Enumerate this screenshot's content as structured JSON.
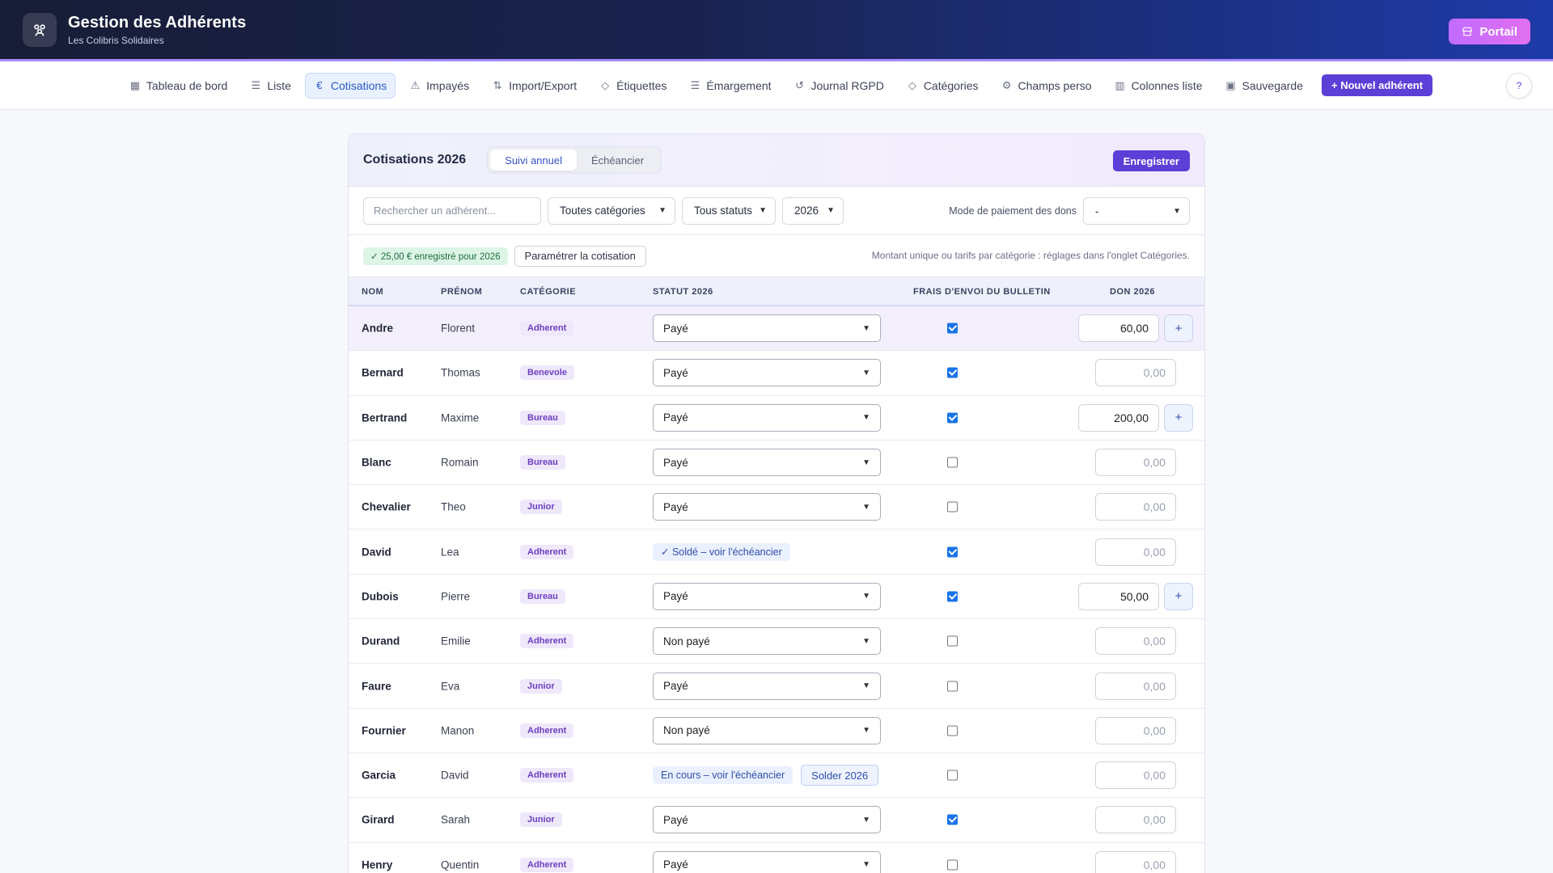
{
  "app": {
    "title": "Gestion des Adhérents",
    "subtitle": "Les Colibris Solidaires",
    "portal_label": "Portail"
  },
  "nav": {
    "items": [
      {
        "label": "Tableau de bord",
        "icon": "grid-icon"
      },
      {
        "label": "Liste",
        "icon": "list-icon"
      },
      {
        "label": "Cotisations",
        "icon": "euro-icon",
        "active": true
      },
      {
        "label": "Impayés",
        "icon": "warning-icon"
      },
      {
        "label": "Import/Export",
        "icon": "file-icon"
      },
      {
        "label": "Étiquettes",
        "icon": "tag-icon"
      },
      {
        "label": "Émargement",
        "icon": "list-icon"
      },
      {
        "label": "Journal RGPD",
        "icon": "history-icon"
      },
      {
        "label": "Catégories",
        "icon": "tag-icon"
      },
      {
        "label": "Champs perso",
        "icon": "gear-icon"
      },
      {
        "label": "Colonnes liste",
        "icon": "columns-icon"
      },
      {
        "label": "Sauvegarde",
        "icon": "save-icon"
      }
    ],
    "new_label": "+ Nouvel adhérent",
    "help_label": "?"
  },
  "card": {
    "title": "Cotisations 2026",
    "tabs": [
      "Suivi annuel",
      "Échéancier"
    ],
    "save_label": "Enregistrer"
  },
  "filters": {
    "search_placeholder": "Rechercher un adhérent...",
    "category": "Toutes catégories",
    "status": "Tous statuts",
    "year": "2026",
    "don_mode_label": "Mode de paiement des dons",
    "don_mode_value": "-"
  },
  "info": {
    "saved_pill": "✓ 25,00 € enregistré pour 2026",
    "param_label": "Paramétrer la cotisation",
    "note": "Montant unique ou tarifs par catégorie : réglages dans l'onglet Catégories."
  },
  "table": {
    "headers": {
      "nom": "NOM",
      "prenom": "PRÉNOM",
      "categorie": "CATÉGORIE",
      "statut": "STATUT 2026",
      "frais": "FRAIS D'ENVOI DU BULLETIN",
      "don": "DON 2026"
    },
    "rows": [
      {
        "nom": "Andre",
        "prenom": "Florent",
        "cat": "Adherent",
        "statut": "Payé",
        "frais": true,
        "don": "60,00",
        "plus": true
      },
      {
        "nom": "Bernard",
        "prenom": "Thomas",
        "cat": "Benevole",
        "statut": "Payé",
        "frais": true,
        "don": "0,00",
        "plus": false
      },
      {
        "nom": "Bertrand",
        "prenom": "Maxime",
        "cat": "Bureau",
        "statut": "Payé",
        "frais": true,
        "don": "200,00",
        "plus": true
      },
      {
        "nom": "Blanc",
        "prenom": "Romain",
        "cat": "Bureau",
        "statut": "Payé",
        "frais": false,
        "don": "0,00",
        "plus": false
      },
      {
        "nom": "Chevalier",
        "prenom": "Theo",
        "cat": "Junior",
        "statut": "Payé",
        "frais": false,
        "don": "0,00",
        "plus": false
      },
      {
        "nom": "David",
        "prenom": "Lea",
        "cat": "Adherent",
        "statut_pill": "✓ Soldé – voir l'échéancier",
        "frais": true,
        "don": "0,00",
        "plus": false
      },
      {
        "nom": "Dubois",
        "prenom": "Pierre",
        "cat": "Bureau",
        "statut": "Payé",
        "frais": true,
        "don": "50,00",
        "plus": true
      },
      {
        "nom": "Durand",
        "prenom": "Emilie",
        "cat": "Adherent",
        "statut": "Non payé",
        "frais": false,
        "don": "0,00",
        "plus": false
      },
      {
        "nom": "Faure",
        "prenom": "Eva",
        "cat": "Junior",
        "statut": "Payé",
        "frais": false,
        "don": "0,00",
        "plus": false
      },
      {
        "nom": "Fournier",
        "prenom": "Manon",
        "cat": "Adherent",
        "statut": "Non payé",
        "frais": false,
        "don": "0,00",
        "plus": false
      },
      {
        "nom": "Garcia",
        "prenom": "David",
        "cat": "Adherent",
        "statut_pill": "En cours – voir l'échéancier",
        "solder": "Solder 2026",
        "frais": false,
        "don": "0,00",
        "plus": false
      },
      {
        "nom": "Girard",
        "prenom": "Sarah",
        "cat": "Junior",
        "statut": "Payé",
        "frais": true,
        "don": "0,00",
        "plus": false
      },
      {
        "nom": "Henry",
        "prenom": "Quentin",
        "cat": "Adherent",
        "statut": "Payé",
        "frais": false,
        "don": "0,00",
        "plus": false
      }
    ]
  }
}
